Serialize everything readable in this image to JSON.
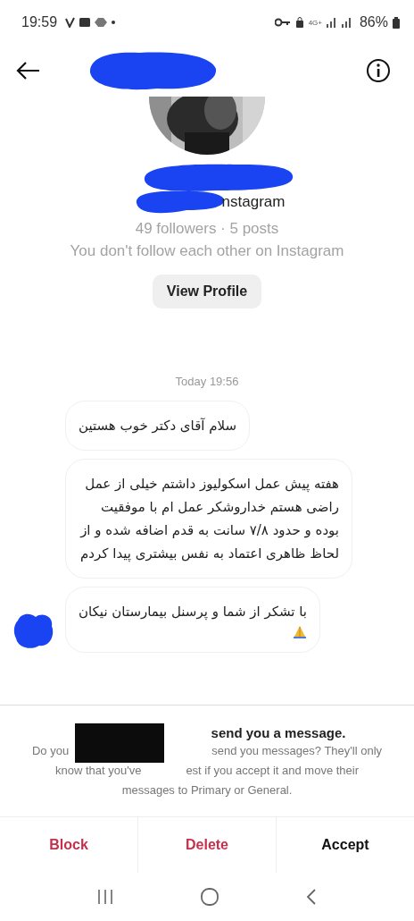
{
  "status_bar": {
    "time": "19:59",
    "network": "4G+",
    "battery": "86%"
  },
  "profile": {
    "username_fragment": "nstagram",
    "stats": "49 followers · 5 posts",
    "follow_note": "You don't follow each other on Instagram",
    "button": "View Profile"
  },
  "chat": {
    "timestamp": "Today 19:56",
    "messages": [
      {
        "text": "سلام آقای دکتر خوب هستین",
        "emoji": false
      },
      {
        "text": "هفته پیش عمل اسکولیوز داشتم خیلی از عمل راضی هستم خداروشکر عمل ام با موفقیت بوده و حدود ۷/۸ سانت به قدم اضافه شده و از لحاظ ظاهری اعتماد به نفس بیشتری پیدا کردم",
        "emoji": false
      },
      {
        "text": "با تشکر از شما و پرسنل بیمارستان نیکان",
        "emoji": true
      }
    ]
  },
  "request": {
    "title": "send you a message.",
    "body_lines": [
      [
        "Do you",
        "send you messages? They'll only"
      ],
      [
        "know that you've",
        "est if you accept it and move their"
      ],
      [
        "messages to Primary or General."
      ]
    ]
  },
  "actions": [
    {
      "label": "Block",
      "kind": "destructive"
    },
    {
      "label": "Delete",
      "kind": "destructive"
    },
    {
      "label": "Accept",
      "kind": "primary"
    }
  ]
}
